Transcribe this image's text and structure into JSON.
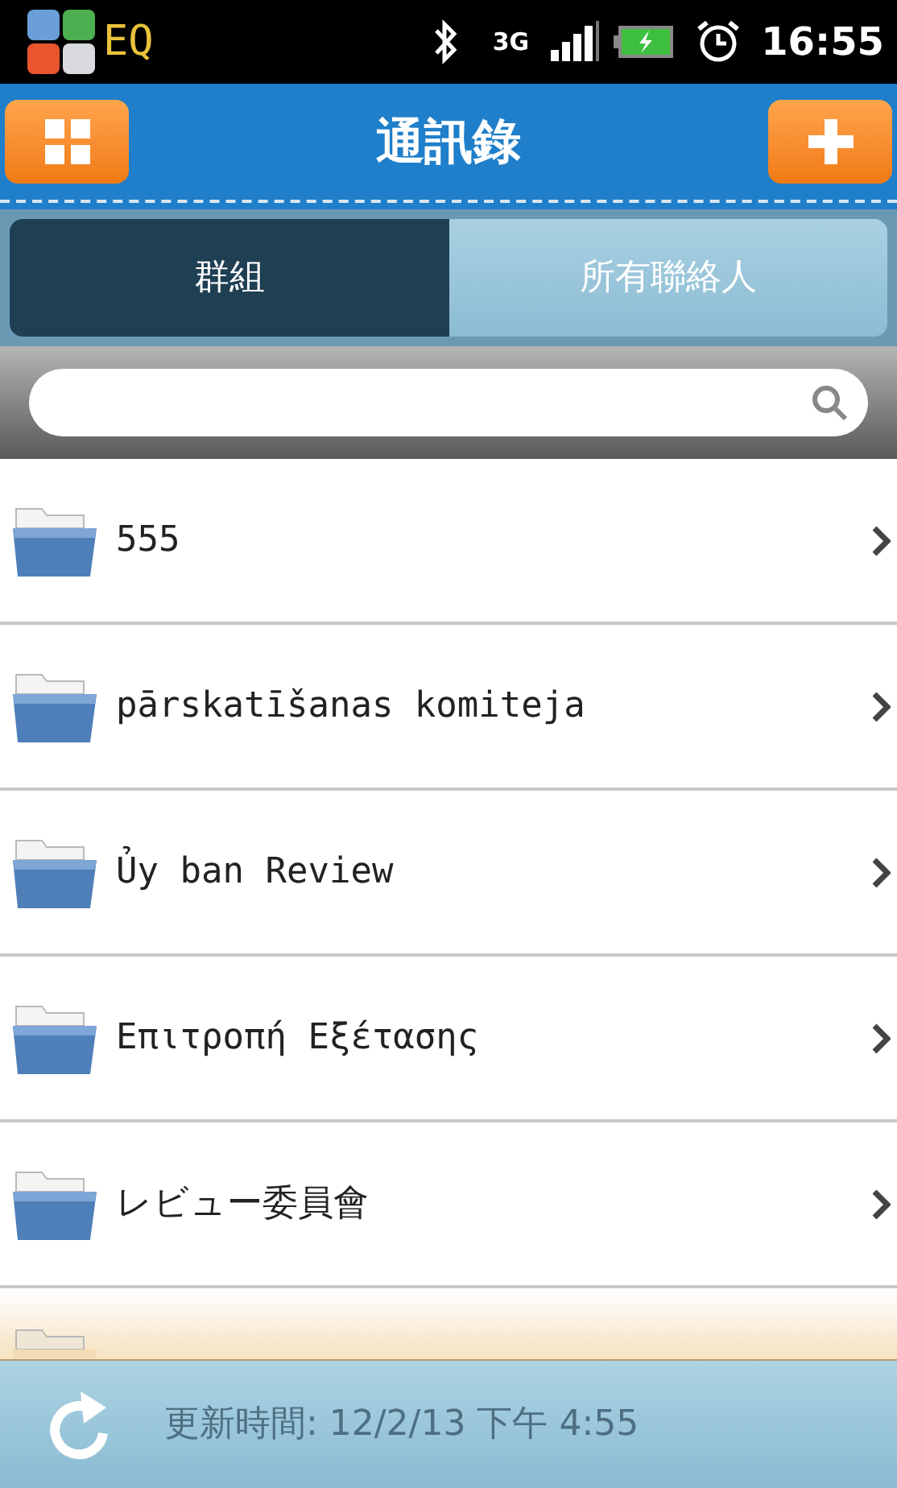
{
  "status_bar": {
    "app_label": "EQ",
    "network": "3G",
    "time": "16:55"
  },
  "header": {
    "title": "通訊錄"
  },
  "tabs": [
    {
      "label": "群組",
      "selected": true
    },
    {
      "label": "所有聯絡人",
      "selected": false
    }
  ],
  "groups": [
    {
      "name": "555"
    },
    {
      "name": "pārskatīšanas komiteja"
    },
    {
      "name": "Ủy ban Review"
    },
    {
      "name": "Επιτροπή Εξέτασης"
    },
    {
      "name": "レビュー委員會"
    }
  ],
  "footer": {
    "updated": "更新時間: 12/2/13 下午 4:55"
  }
}
